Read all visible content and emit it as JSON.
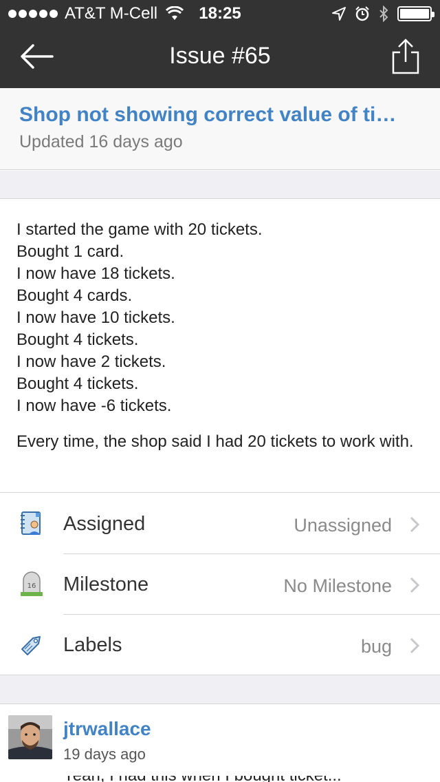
{
  "status_bar": {
    "carrier": "AT&T M-Cell",
    "time": "18:25",
    "battery_level": 1.0
  },
  "nav": {
    "title": "Issue #65",
    "back_icon": "back-arrow-icon",
    "share_icon": "share-icon"
  },
  "issue": {
    "title": "Shop not showing correct value of ti…",
    "updated": "Updated 16 days ago",
    "body_lines": [
      "I started the game with 20 tickets.",
      "Bought 1 card.",
      "I now have 18 tickets.",
      "Bought 4 cards.",
      "I now have 10 tickets.",
      "Bought 4 tickets.",
      "I now have 2 tickets.",
      "Bought 4 tickets.",
      "I now have -6 tickets."
    ],
    "body_paragraph": "Every time, the shop said I had 20 tickets to work with."
  },
  "meta": [
    {
      "label": "Assigned",
      "value": "Unassigned",
      "icon": "assignee-icon"
    },
    {
      "label": "Milestone",
      "value": "No Milestone",
      "icon": "milestone-icon",
      "icon_text": "16"
    },
    {
      "label": "Labels",
      "value": "bug",
      "icon": "label-tag-icon"
    }
  ],
  "comment": {
    "user": "jtrwallace",
    "time": "19 days ago",
    "text_partial": "Yeah, I had this when I bought ticket..."
  },
  "colors": {
    "bar": "#333333",
    "link": "#4183c4",
    "background_gap": "#efeff4"
  }
}
